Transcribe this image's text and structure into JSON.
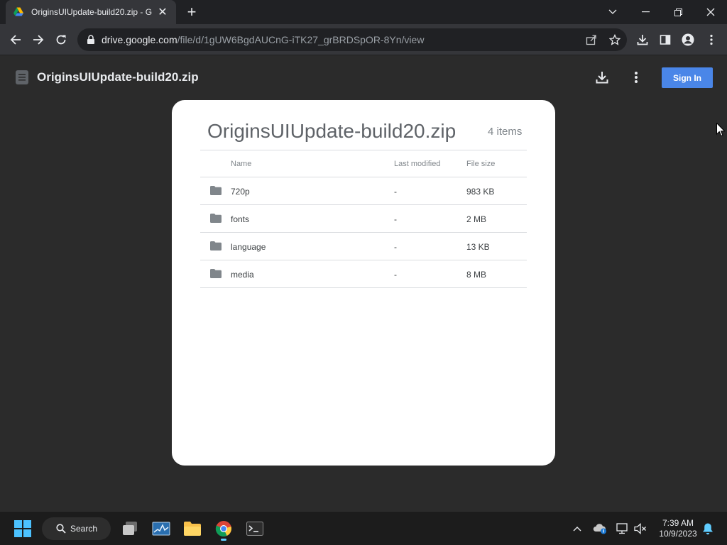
{
  "browser": {
    "tab_title": "OriginsUIUpdate-build20.zip - G",
    "url_host": "drive.google.com",
    "url_path": "/file/d/1gUW6BgdAUCnG-iTK27_grBRDSpOR-8Yn/view",
    "new_tab_icon": "plus-icon",
    "window_controls": [
      "chevron-down-icon",
      "minimize-icon",
      "restore-icon",
      "close-icon"
    ]
  },
  "drive": {
    "file_name": "OriginsUIUpdate-build20.zip",
    "sign_in_label": "Sign In",
    "accent": "#4a86e8"
  },
  "preview": {
    "zip_name": "OriginsUIUpdate-build20.zip",
    "item_count": "4 items",
    "columns": [
      "Name",
      "Last modified",
      "File size"
    ],
    "rows": [
      {
        "name": "720p",
        "modified": "-",
        "size": "983 KB"
      },
      {
        "name": "fonts",
        "modified": "-",
        "size": "2 MB"
      },
      {
        "name": "language",
        "modified": "-",
        "size": "13 KB"
      },
      {
        "name": "media",
        "modified": "-",
        "size": "8 MB"
      }
    ]
  },
  "taskbar": {
    "search_label": "Search",
    "time": "7:39 AM",
    "date": "10/9/2023"
  }
}
